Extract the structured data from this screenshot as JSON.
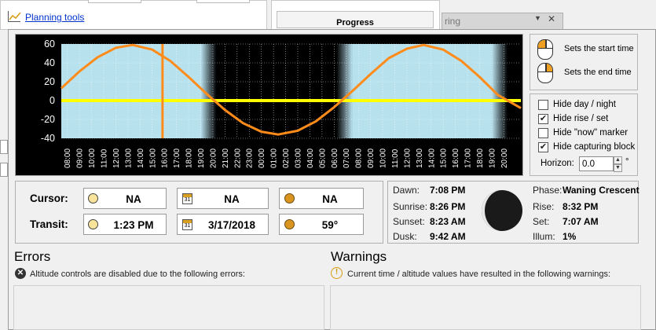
{
  "background": {
    "planning_link": "Planning tools",
    "progress_tab": "Progress",
    "side_title_fragment": "ring"
  },
  "mouse_hints": [
    {
      "label": "Sets the start time",
      "icon": "left-click-mouse-icon"
    },
    {
      "label": "Sets the end time",
      "icon": "right-click-mouse-icon"
    }
  ],
  "options": {
    "items": [
      {
        "label": "Hide day / night",
        "checked": false
      },
      {
        "label": "Hide rise / set",
        "checked": true
      },
      {
        "label": "Hide \"now\" marker",
        "checked": false
      },
      {
        "label": "Hide capturing block",
        "checked": true
      }
    ],
    "horizon_label": "Horizon:",
    "horizon_value": "0.0",
    "horizon_unit": "°"
  },
  "position": {
    "cursor_label": "Cursor:",
    "transit_label": "Transit:",
    "cursor_time": "NA",
    "cursor_date": "NA",
    "cursor_alt": "NA",
    "transit_time": "1:23 PM",
    "transit_date": "3/17/2018",
    "transit_alt": "59°"
  },
  "sun": {
    "dawn_label": "Dawn:",
    "dawn": "7:08 PM",
    "sunrise_label": "Sunrise:",
    "sunrise": "8:26 PM",
    "sunset_label": "Sunset:",
    "sunset": "8:23 AM",
    "dusk_label": "Dusk:",
    "dusk": "9:42 AM"
  },
  "moon": {
    "phase_label": "Phase:",
    "phase": "Waning Crescent",
    "rise_label": "Rise:",
    "rise": "8:32 PM",
    "set_label": "Set:",
    "set": "7:07 AM",
    "illum_label": "Illum:",
    "illum": "1%"
  },
  "errors": {
    "title": "Errors",
    "message": "Altitude controls are disabled due to the following errors:"
  },
  "warnings": {
    "title": "Warnings",
    "message": "Current time / altitude values have resulted in the following warnings:"
  },
  "chart_data": {
    "type": "line",
    "ylim": [
      -40,
      60
    ],
    "yticks": [
      60,
      40,
      20,
      0,
      -20,
      -40
    ],
    "x_hours": [
      "08:00",
      "09:00",
      "10:00",
      "11:00",
      "12:00",
      "13:00",
      "14:00",
      "15:00",
      "16:00",
      "17:00",
      "18:00",
      "19:00",
      "20:00",
      "21:00",
      "22:00",
      "23:00",
      "00:00",
      "01:00",
      "02:00",
      "03:00",
      "04:00",
      "05:00",
      "06:00",
      "07:00",
      "08:00",
      "09:00",
      "10:00",
      "11:00",
      "12:00",
      "13:00",
      "14:00",
      "15:00",
      "16:00",
      "17:00",
      "18:00",
      "19:00",
      "20:00"
    ],
    "x_start_hour": 7.5,
    "x_end_hour": 45.4,
    "altitude_series": {
      "x_hour": [
        7.5,
        9.0,
        10.5,
        12.0,
        13.38,
        15.0,
        16.5,
        18.0,
        19.5,
        21.0,
        22.5,
        24.0,
        25.38,
        27.0,
        28.5,
        30.0,
        31.5,
        33.0,
        34.5,
        36.0,
        37.38,
        39.0,
        40.5,
        42.0,
        43.5,
        45.4
      ],
      "altitude": [
        13,
        31,
        46,
        56,
        59,
        54,
        42,
        25,
        7,
        -10,
        -24,
        -33,
        -36,
        -32,
        -22,
        -7,
        10,
        28,
        45,
        55,
        59,
        54,
        42,
        25,
        6,
        -8
      ]
    },
    "cursor_marker_hour": 15.85,
    "horizon_value": 0,
    "daylight_bands": [
      [
        7.5,
        19.0
      ],
      [
        31.5,
        43.0
      ]
    ],
    "colors": {
      "curve": "#ff8c1a",
      "horizon": "#ffff00",
      "marker": "#ff8c1a",
      "sky": "#b8e1ee",
      "night": "#000000"
    }
  }
}
